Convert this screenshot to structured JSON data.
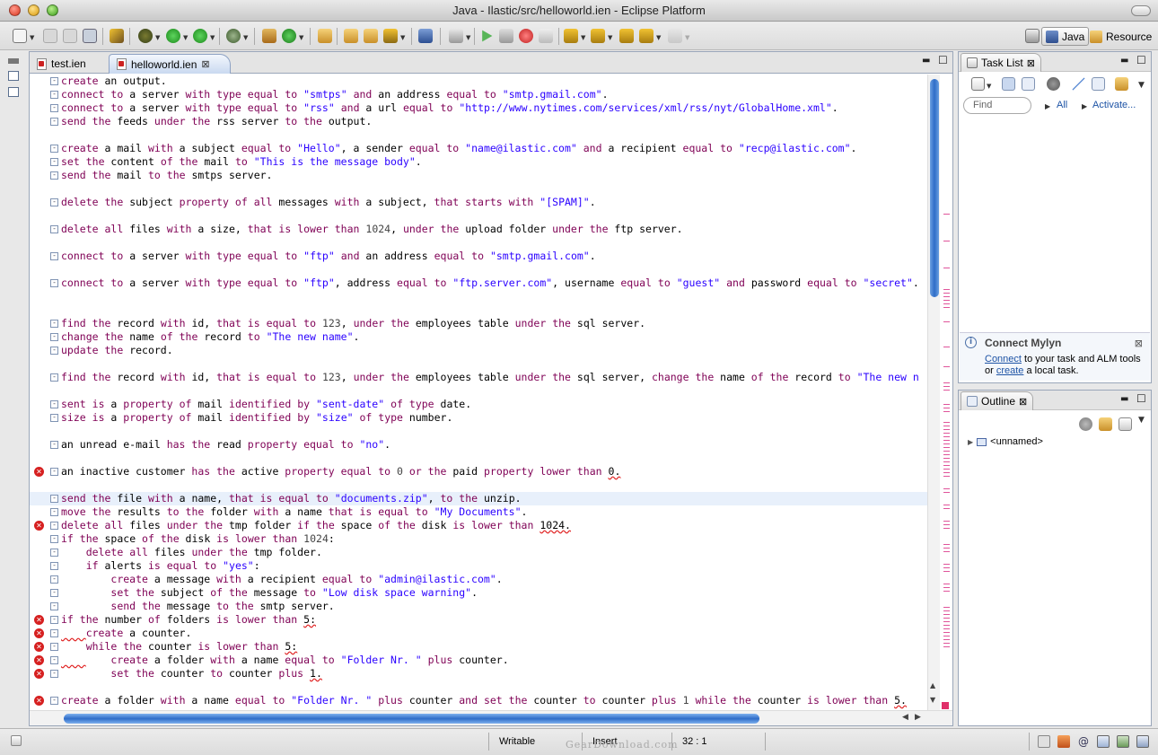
{
  "window": {
    "title": "Java - Ilastic/src/helloworld.ien - Eclipse Platform"
  },
  "perspectives": {
    "java": "Java",
    "resource": "Resource"
  },
  "editor": {
    "tabs": [
      {
        "label": "test.ien",
        "active": false
      },
      {
        "label": "helloworld.ien",
        "active": true
      }
    ]
  },
  "task_list": {
    "tab_label": "Task List",
    "find_placeholder": "Find",
    "all_label": "All",
    "activate_label": "Activate..."
  },
  "mylyn": {
    "title": "Connect Mylyn",
    "connect_link": "Connect",
    "text_mid": " to your task and ALM tools or ",
    "create_link": "create",
    "text_end": " a local task."
  },
  "outline": {
    "tab_label": "Outline",
    "root_item": "<unnamed>"
  },
  "status_bar": {
    "writable": "Writable",
    "insert": "Insert",
    "position": "32 : 1",
    "watermark": "GearDownload.com"
  },
  "colors": {
    "keyword": "#7f0055",
    "string": "#2a00ff",
    "error": "#d62020",
    "selection": "#2f6dc8"
  }
}
